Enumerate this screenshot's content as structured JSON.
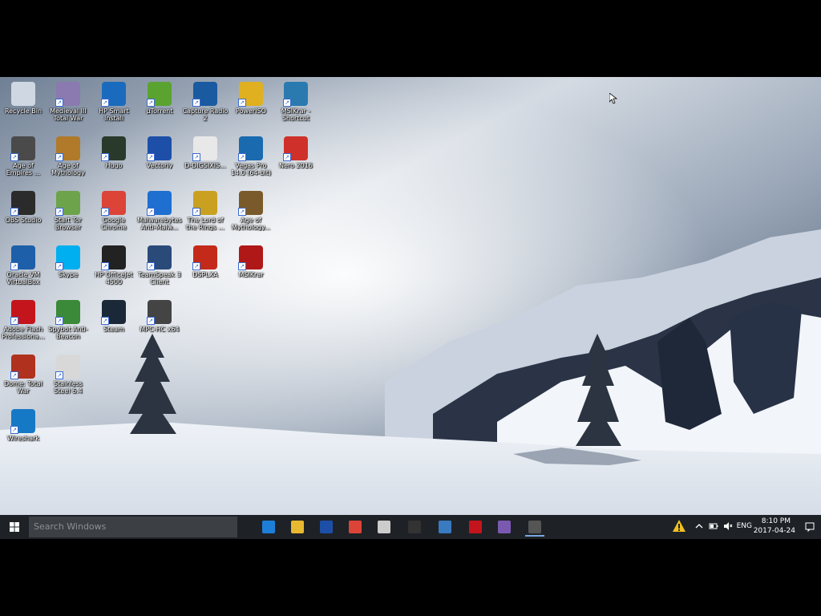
{
  "desktop": {
    "icons": [
      {
        "label": "Recycle Bin",
        "icon": "recycle-bin-icon",
        "color": "#cfd8e2"
      },
      {
        "label": "Age of Empires ...",
        "icon": "age-of-empires-icon",
        "color": "#4a4a4a"
      },
      {
        "label": "OBS Studio",
        "icon": "obs-icon",
        "color": "#2b2b2b"
      },
      {
        "label": "Oracle VM VirtualBox",
        "icon": "virtualbox-icon",
        "color": "#1d5fa8"
      },
      {
        "label": "Adobe Flash Professiona...",
        "icon": "adobe-flash-icon",
        "color": "#c4151c"
      },
      {
        "label": "Dome: Total War",
        "icon": "total-war-icon",
        "color": "#b0321e"
      },
      {
        "label": "Wireshark",
        "icon": "wireshark-icon",
        "color": "#1679c5"
      },
      {
        "label": "Medieval III Total War",
        "icon": "medieval-icon",
        "color": "#8a7ab0"
      },
      {
        "label": "Age of Mythology",
        "icon": "age-of-mythology-icon",
        "color": "#b07a2a"
      },
      {
        "label": "Start Tor Browser",
        "icon": "tor-icon",
        "color": "#6da34a"
      },
      {
        "label": "Skype",
        "icon": "skype-icon",
        "color": "#00aff0"
      },
      {
        "label": "Spybot Anti-Beacon",
        "icon": "spybot-icon",
        "color": "#3a8a3a"
      },
      {
        "label": "Stainless Steel 6.4",
        "icon": "stainless-steel-icon",
        "color": "#d8d8d8"
      },
      {
        "label": "HP Smart Install",
        "icon": "hp-smart-icon",
        "color": "#1a6bbd"
      },
      {
        "label": "Hugo",
        "icon": "hugo-icon",
        "color": "#2a3a2a"
      },
      {
        "label": "Google Chrome",
        "icon": "chrome-icon",
        "color": "#db4437"
      },
      {
        "label": "HP OfficeJet 4500",
        "icon": "printer-icon",
        "color": "#222222"
      },
      {
        "label": "Steam",
        "icon": "steam-icon",
        "color": "#1b2838"
      },
      {
        "label": "µTorrent",
        "icon": "utorrent-icon",
        "color": "#5aa330"
      },
      {
        "label": "Vectorly",
        "icon": "vectorly-icon",
        "color": "#1d4fa8"
      },
      {
        "label": "Malwarebytes Anti-Malw...",
        "icon": "malwarebytes-icon",
        "color": "#1e6fd0"
      },
      {
        "label": "TeamSpeak 3 Client",
        "icon": "teamspeak-icon",
        "color": "#2a4a7a"
      },
      {
        "label": "MPC-HC x64",
        "icon": "mpc-hc-icon",
        "color": "#444444"
      },
      {
        "label": "Capture Radio 2",
        "icon": "capture-radio-icon",
        "color": "#1a5aa0"
      },
      {
        "label": "D-DIGSIXIS...",
        "icon": "document-icon",
        "color": "#e8e8e8"
      },
      {
        "label": "The Lord of the Rings ...",
        "icon": "lotr-icon",
        "color": "#c9a020"
      },
      {
        "label": "DSPLXA",
        "icon": "dsplxa-icon",
        "color": "#c42a1a"
      },
      {
        "label": "PowerISO",
        "icon": "poweriso-icon",
        "color": "#e0b020"
      },
      {
        "label": "Vegas Pro 14.0 (64-bit)",
        "icon": "vegas-pro-icon",
        "color": "#1a6ab0"
      },
      {
        "label": "Age of Mythology...",
        "icon": "aom-extended-icon",
        "color": "#7a5a2a"
      },
      {
        "label": "MSIKrar",
        "icon": "msi-icon",
        "color": "#b01818"
      },
      {
        "label": "MSIKrar - Shortcut",
        "icon": "msi-shortcut-icon",
        "color": "#2a7ab0"
      },
      {
        "label": "Nero 2016",
        "icon": "nero-icon",
        "color": "#d0302a"
      }
    ]
  },
  "taskbar": {
    "search_placeholder": "Search Windows",
    "apps": [
      {
        "name": "edge-icon",
        "color": "#1e7fd8"
      },
      {
        "name": "file-explorer-icon",
        "color": "#e8b830"
      },
      {
        "name": "vectorly-taskbar-icon",
        "color": "#1d4fa8"
      },
      {
        "name": "chrome-taskbar-icon",
        "color": "#db4437"
      },
      {
        "name": "tool-taskbar-icon",
        "color": "#cccccc"
      },
      {
        "name": "terminal-taskbar-icon",
        "color": "#333333"
      },
      {
        "name": "photo-taskbar-icon",
        "color": "#3a7ac0"
      },
      {
        "name": "flash-taskbar-icon",
        "color": "#c4151c"
      },
      {
        "name": "media-taskbar-icon",
        "color": "#7a5ab0"
      },
      {
        "name": "obs-taskbar-icon",
        "color": "#555555"
      }
    ],
    "language": "ENG",
    "time": "8:10 PM",
    "date": "2017-04-24"
  }
}
